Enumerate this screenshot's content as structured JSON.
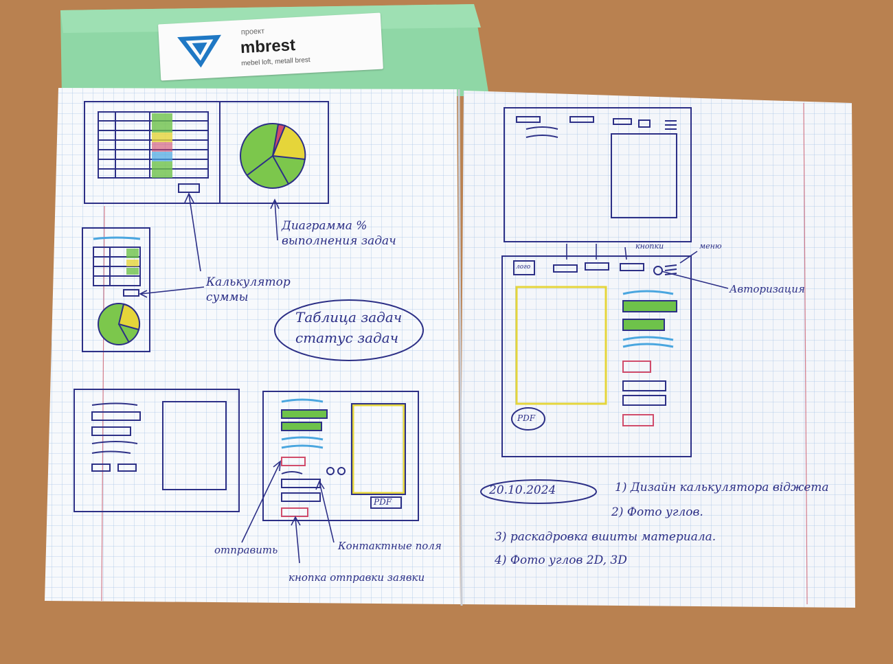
{
  "label": {
    "small": "проект",
    "brand": "mbrest",
    "tagline": "mebel loft, metall brest"
  },
  "notes": {
    "chart_note": "Диаграмма %\nвыполнения задач",
    "calculator_note": "Калькулятор\nсуммы",
    "table_note": "Таблица задач\nстатус задач",
    "send_button_note": "отправить",
    "contacts_note": "Контактные поля",
    "button_note": "кнопка отправки заявки",
    "buttons_note": "кнопки",
    "menu_note": "меню",
    "auth_note": "Авторизация",
    "logo_note": "лого",
    "pdf_left": "PDF",
    "pdf_right": "PDF",
    "date": "20.10.2024",
    "list1": "1) Дизайн калькулятора віджета",
    "list2": "2) Фото углов.",
    "list3": "3) раскадровка вшиты материала.",
    "list4": "4) Фото углов 2D, 3D"
  },
  "colors": {
    "pen": "#2c2f86",
    "green": "#6ec24a",
    "yellow": "#e5d53a",
    "red": "#d04b6a",
    "blue": "#4aa6df",
    "folder": "#8fd7a6",
    "desk": "#b98150"
  }
}
